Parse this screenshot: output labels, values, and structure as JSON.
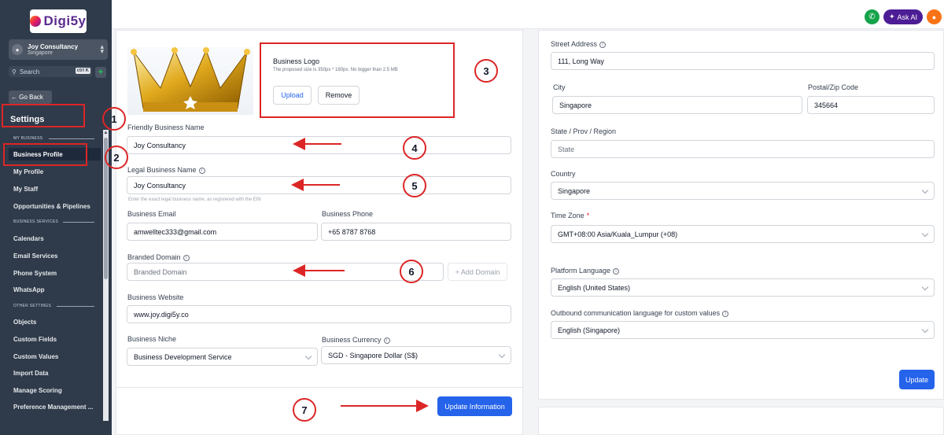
{
  "sidebar": {
    "logo_text": "Digi5y",
    "account_name": "Joy Consultancy",
    "account_location": "Singapore",
    "search_placeholder": "Search",
    "search_shortcut": "ctrl K",
    "go_back": "← Go Back",
    "title": "Settings",
    "sections": {
      "my_business": "MY BUSINESS",
      "business_services": "BUSINESS SERVICES",
      "other_settings": "OTHER SETTINGS"
    },
    "items": [
      {
        "label": "Business Profile",
        "active": true
      },
      {
        "label": "My Profile"
      },
      {
        "label": "My Staff"
      },
      {
        "label": "Opportunities & Pipelines"
      },
      {
        "label": "Calendars"
      },
      {
        "label": "Email Services"
      },
      {
        "label": "Phone System"
      },
      {
        "label": "WhatsApp"
      },
      {
        "label": "Objects"
      },
      {
        "label": "Custom Fields"
      },
      {
        "label": "Custom Values"
      },
      {
        "label": "Import Data"
      },
      {
        "label": "Manage Scoring"
      },
      {
        "label": "Preference Management ..."
      }
    ]
  },
  "topbar": {
    "ask_ai": "Ask AI"
  },
  "left_form": {
    "business_logo_title": "Business Logo",
    "business_logo_hint": "The proposed size is 350px * 180px. No bigger than 2.5 MB",
    "upload": "Upload",
    "remove": "Remove",
    "friendly_name_label": "Friendly Business Name",
    "friendly_name_value": "Joy Consultancy",
    "legal_name_label": "Legal Business Name",
    "legal_name_value": "Joy Consultancy",
    "legal_name_hint": "Enter the exact legal business name, as registered with the EIN",
    "email_label": "Business Email",
    "email_value": "amwelltec333@gmail.com",
    "phone_label": "Business Phone",
    "phone_value": "+65 8787 8768",
    "domain_label": "Branded Domain",
    "domain_placeholder": "Branded Domain",
    "add_domain": "+ Add Domain",
    "website_label": "Business Website",
    "website_value": "www.joy.digi5y.co",
    "niche_label": "Business Niche",
    "niche_value": "Business Development Service",
    "currency_label": "Business Currency",
    "currency_value": "SGD - Singapore Dollar (S$)",
    "update_information": "Update Information"
  },
  "right_form": {
    "street_label": "Street Address",
    "street_value": "111, Long Way",
    "city_label": "City",
    "city_value": "Singapore",
    "postal_label": "Postal/Zip Code",
    "postal_value": "345664",
    "state_label": "State / Prov / Region",
    "state_placeholder": "State",
    "country_label": "Country",
    "country_value": "Singapore",
    "timezone_label": "Time Zone",
    "timezone_required": "*",
    "timezone_value": "GMT+08:00 Asia/Kuala_Lumpur (+08)",
    "platform_language_label": "Platform Language",
    "platform_language_value": "English (United States)",
    "outbound_language_label": "Outbound communication language for custom values",
    "outbound_language_value": "English (Singapore)",
    "update": "Update"
  },
  "annotations": {
    "numbers": [
      "1",
      "2",
      "3",
      "4",
      "5",
      "6",
      "7"
    ],
    "color": "#dc2626"
  },
  "colors": {
    "sidebar_bg": "#2f3a4a",
    "primary": "#2563eb"
  }
}
